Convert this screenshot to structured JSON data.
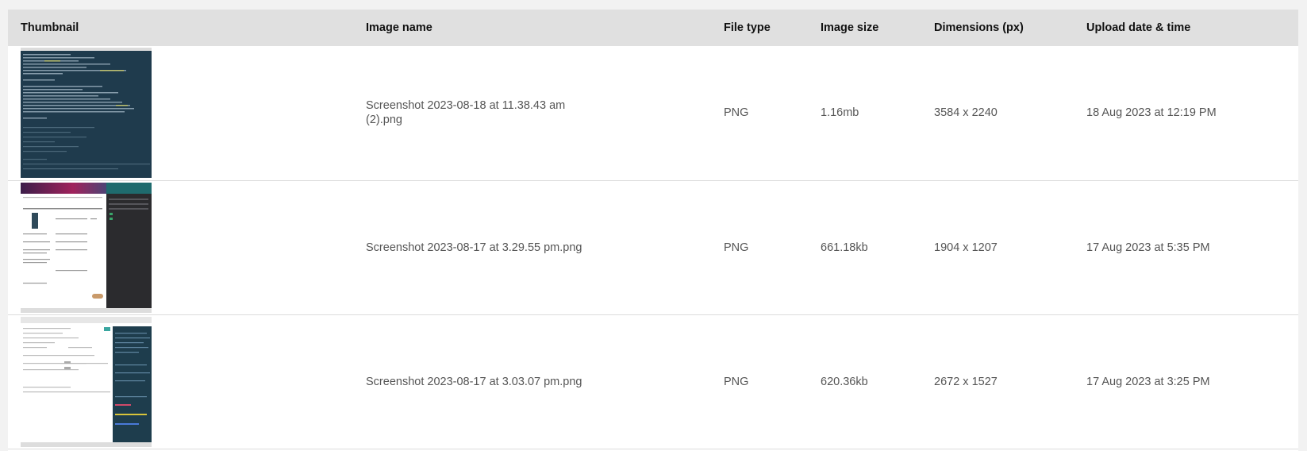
{
  "columns": {
    "thumbnail": "Thumbnail",
    "image_name": "Image name",
    "file_type": "File type",
    "image_size": "Image size",
    "dimensions": "Dimensions (px)",
    "upload": "Upload date & time"
  },
  "rows": [
    {
      "name": "Screenshot 2023-08-18 at 11.38.43 am (2).png",
      "type": "PNG",
      "size": "1.16mb",
      "dimensions": "3584 x 2240",
      "uploaded": "18 Aug 2023 at 12:19 PM",
      "thumbnail_style": "dark-terminal"
    },
    {
      "name": "Screenshot 2023-08-17 at 3.29.55 pm.png",
      "type": "PNG",
      "size": "661.18kb",
      "dimensions": "1904 x 1207",
      "uploaded": "17 Aug 2023 at 5:35 PM",
      "thumbnail_style": "light-table-with-dark-panel"
    },
    {
      "name": "Screenshot 2023-08-17 at 3.03.07 pm.png",
      "type": "PNG",
      "size": "620.36kb",
      "dimensions": "2672 x 1527",
      "uploaded": "17 Aug 2023 at 3:25 PM",
      "thumbnail_style": "light-form-with-dark-editor"
    }
  ],
  "colors": {
    "header_bg": "#e0e0e0",
    "row_border": "#dcdcdc",
    "terminal_bg": "#1f3b4d",
    "dark_panel": "#2b2b2e"
  }
}
